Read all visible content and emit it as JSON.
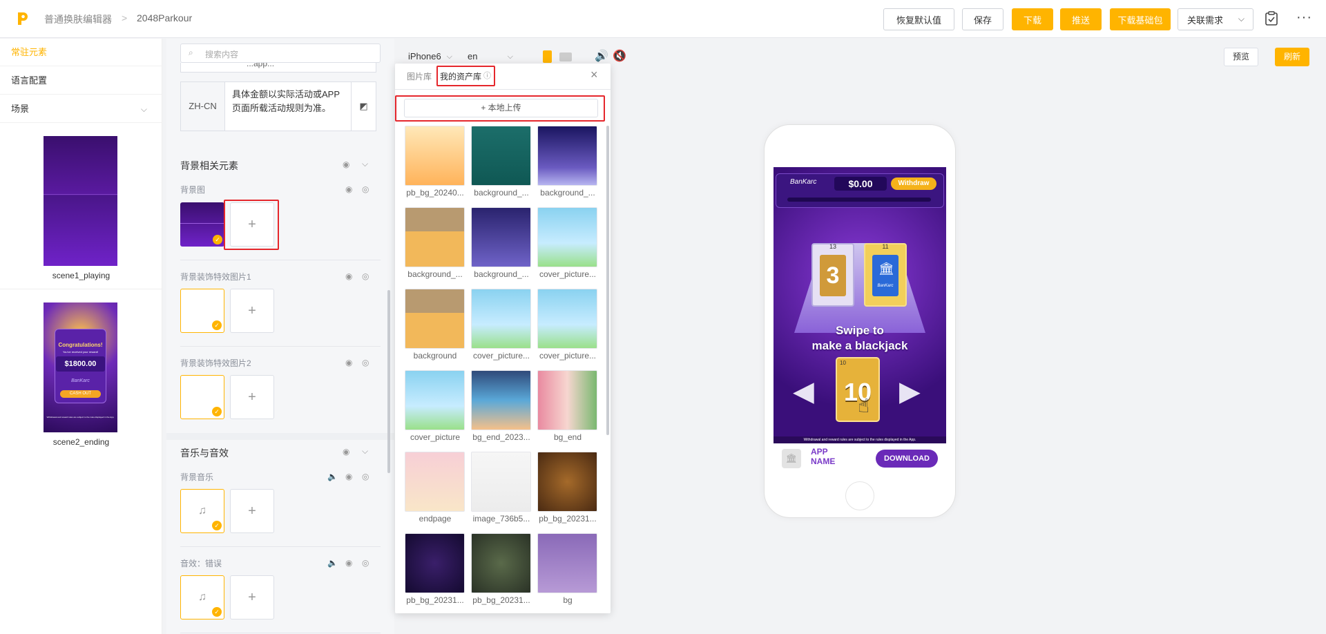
{
  "header": {
    "breadcrumb_root": "普通换肤编辑器",
    "breadcrumb_sep": ">",
    "breadcrumb_current": "2048Parkour",
    "buttons": {
      "restore": "恢复默认值",
      "save": "保存",
      "download": "下载",
      "push": "推送",
      "download_base": "下载基础包",
      "related": "关联需求"
    }
  },
  "leftnav": {
    "items": [
      "常驻元素",
      "语言配置",
      "场景"
    ],
    "scenes": [
      "scene1_playing",
      "scene2_ending"
    ],
    "scene2_preview": {
      "title": "Congratulations!",
      "subtitle": "You've received your reward!",
      "amount": "$1800.00",
      "brand": "BanKarc",
      "button": "CASH OUT",
      "footer": "Withdrawal and reward rules are subject to the rules displayed in the App."
    }
  },
  "props": {
    "search_placeholder": "搜索内容",
    "partial_row_text": "...app...",
    "lang_code": "ZH-CN",
    "lang_text": "具体金额以实际活动或APP页面所载活动规则为准。",
    "bg_section": "背景相关元素",
    "bg_image": "背景图",
    "bg_deco1": "背景装饰特效图片1",
    "bg_deco2": "背景装饰特效图片2",
    "music_section": "音乐与音效",
    "bg_music": "背景音乐",
    "sfx_wrong": "音效：错误"
  },
  "toolbar": {
    "device": "iPhone6",
    "lang": "en",
    "preview": "预览",
    "refresh": "刷新"
  },
  "popup": {
    "tab_library": "图片库",
    "tab_my_assets": "我的资产库",
    "upload": "本地上传",
    "upload_icon": "+",
    "assets": [
      {
        "name": "pb_bg_20240...",
        "color": "linear-gradient(#ffe8b8,#ffb35a)"
      },
      {
        "name": "background_...",
        "color": "linear-gradient(#1c6e6a,#0f5854)"
      },
      {
        "name": "background_...",
        "color": "linear-gradient(#1a1560,#6a5ac0 70%,#b7b5f0)"
      },
      {
        "name": "background_...",
        "color": "linear-gradient(#b89a70 40%,#f2b85a 40%)"
      },
      {
        "name": "background_...",
        "color": "linear-gradient(#2a236e,#6f63c8)"
      },
      {
        "name": "cover_picture...",
        "color": "linear-gradient(#8ad2f0,#c7ecff 60%,#9ae08a)"
      },
      {
        "name": "background",
        "color": "linear-gradient(#b89a70 40%,#f2b85a 40%)"
      },
      {
        "name": "cover_picture...",
        "color": "linear-gradient(#8ad2f0,#c7ecff 60%,#9ae08a)"
      },
      {
        "name": "cover_picture...",
        "color": "linear-gradient(#8ad2f0,#c7ecff 60%,#9ae08a)"
      },
      {
        "name": "cover_picture",
        "color": "linear-gradient(#8ad2f0,#c7ecff 60%,#9ae08a)"
      },
      {
        "name": "bg_end_2023...",
        "color": "linear-gradient(#2f4a7a,#5aa8d8 50%,#f5c08a)"
      },
      {
        "name": "bg_end",
        "color": "linear-gradient(90deg,#e98aa0,#f7d6d0 50%,#7ab870)"
      },
      {
        "name": "endpage",
        "color": "linear-gradient(#f7cfd6,#f9e6c8)"
      },
      {
        "name": "image_736b5...",
        "color": "linear-gradient(#f6f6f6,#ececec)"
      },
      {
        "name": "pb_bg_20231...",
        "color": "radial-gradient(circle,#a56a2a,#4a2a12)"
      },
      {
        "name": "pb_bg_20231...",
        "color": "radial-gradient(circle,#3a1f6a,#140a30)"
      },
      {
        "name": "pb_bg_20231...",
        "color": "radial-gradient(circle,#5a6a4a,#2a3226)"
      },
      {
        "name": "bg",
        "color": "linear-gradient(#8a6ab8,#b79ad6)"
      }
    ]
  },
  "phone": {
    "brand": "BanKarc",
    "balance": "$0.00",
    "withdraw": "Withdraw",
    "card_left_num": "13",
    "card_left_value": "3",
    "card_right_num": "11",
    "card_right_brand": "BanKarc",
    "instruction_line1": "Swipe to",
    "instruction_line2": "make a blackjack",
    "center_card": "10",
    "center_card_corner": "10",
    "disclaimer": "Withdrawal and reward rules are subject to the rules displayed in the App.",
    "app_name": "APP NAME",
    "download": "DOWNLOAD"
  },
  "colors": {
    "accent": "#ffb400",
    "highlight_box": "#e5262b"
  }
}
